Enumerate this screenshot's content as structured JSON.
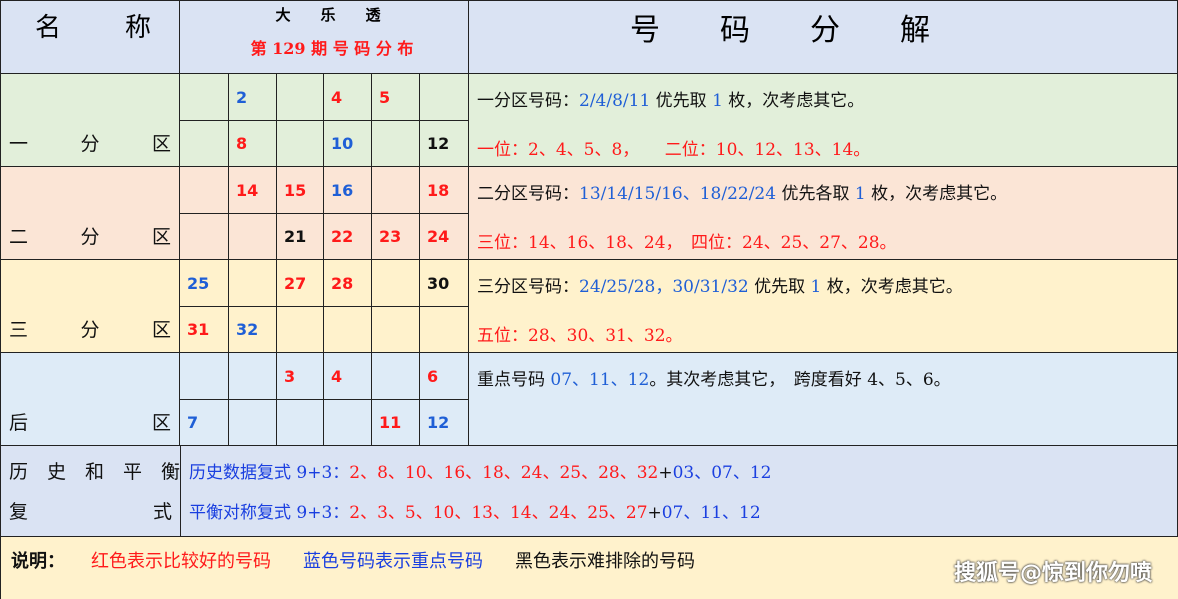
{
  "header": {
    "name_col": "名　　称",
    "subtitle_top": "大　　乐　　透",
    "subtitle_bottom": "第 129 期 号 码 分 布",
    "decompose_title": "号　　码　　分　　解"
  },
  "zones": [
    {
      "label": [
        "一",
        "分",
        "区"
      ],
      "rows": [
        [
          {
            "t": "",
            "c": ""
          },
          {
            "t": "2",
            "c": "blue"
          },
          {
            "t": "",
            "c": ""
          },
          {
            "t": "4",
            "c": "red"
          },
          {
            "t": "5",
            "c": "red"
          },
          {
            "t": "",
            "c": ""
          }
        ],
        [
          {
            "t": "",
            "c": ""
          },
          {
            "t": "8",
            "c": "red"
          },
          {
            "t": "",
            "c": ""
          },
          {
            "t": "10",
            "c": "blue"
          },
          {
            "t": "",
            "c": ""
          },
          {
            "t": "12",
            "c": "black"
          }
        ]
      ],
      "notes": [
        [
          {
            "t": "一分区号码：",
            "c": "black"
          },
          {
            "t": "2/4/8/11",
            "c": "blue"
          },
          {
            "t": " 优先取 ",
            "c": "black"
          },
          {
            "t": "1",
            "c": "blue"
          },
          {
            "t": " 枚，次考虑其它。",
            "c": "black"
          }
        ],
        [
          {
            "t": "一位：2、4、5、8，　　二位：10、12、13、14。",
            "c": "red"
          }
        ]
      ]
    },
    {
      "label": [
        "二",
        "分",
        "区"
      ],
      "rows": [
        [
          {
            "t": "",
            "c": ""
          },
          {
            "t": "14",
            "c": "red"
          },
          {
            "t": "15",
            "c": "red"
          },
          {
            "t": "16",
            "c": "blue"
          },
          {
            "t": "",
            "c": ""
          },
          {
            "t": "18",
            "c": "red"
          }
        ],
        [
          {
            "t": "",
            "c": ""
          },
          {
            "t": "",
            "c": ""
          },
          {
            "t": "21",
            "c": "black"
          },
          {
            "t": "22",
            "c": "red"
          },
          {
            "t": "23",
            "c": "red"
          },
          {
            "t": "24",
            "c": "red"
          }
        ]
      ],
      "notes": [
        [
          {
            "t": "二分区号码：",
            "c": "black"
          },
          {
            "t": "13/14/15/16、18/22/24",
            "c": "blue"
          },
          {
            "t": " 优先各取 ",
            "c": "black"
          },
          {
            "t": "1",
            "c": "blue"
          },
          {
            "t": " 枚，次考虑其它。",
            "c": "black"
          }
        ],
        [
          {
            "t": "三位：14、16、18、24，　四位：24、25、27、28。",
            "c": "red"
          }
        ]
      ]
    },
    {
      "label": [
        "三",
        "分",
        "区"
      ],
      "rows": [
        [
          {
            "t": "25",
            "c": "blue"
          },
          {
            "t": "",
            "c": ""
          },
          {
            "t": "27",
            "c": "red"
          },
          {
            "t": "28",
            "c": "red"
          },
          {
            "t": "",
            "c": ""
          },
          {
            "t": "30",
            "c": "black"
          }
        ],
        [
          {
            "t": "31",
            "c": "red"
          },
          {
            "t": "32",
            "c": "blue"
          },
          {
            "t": "",
            "c": ""
          },
          {
            "t": "",
            "c": ""
          },
          {
            "t": "",
            "c": ""
          },
          {
            "t": "",
            "c": ""
          }
        ]
      ],
      "notes": [
        [
          {
            "t": "三分区号码：",
            "c": "black"
          },
          {
            "t": "24/25/28，30/31/32",
            "c": "blue"
          },
          {
            "t": " 优先取 ",
            "c": "black"
          },
          {
            "t": "1",
            "c": "blue"
          },
          {
            "t": " 枚，次考虑其它。",
            "c": "black"
          }
        ],
        [
          {
            "t": "五位：28、30、31、32。",
            "c": "red"
          }
        ]
      ]
    },
    {
      "label": [
        "后",
        "",
        "区"
      ],
      "rows": [
        [
          {
            "t": "",
            "c": ""
          },
          {
            "t": "",
            "c": ""
          },
          {
            "t": "3",
            "c": "red"
          },
          {
            "t": "4",
            "c": "red"
          },
          {
            "t": "",
            "c": ""
          },
          {
            "t": "6",
            "c": "red"
          }
        ],
        [
          {
            "t": "7",
            "c": "blue"
          },
          {
            "t": "",
            "c": ""
          },
          {
            "t": "",
            "c": ""
          },
          {
            "t": "",
            "c": ""
          },
          {
            "t": "11",
            "c": "red"
          },
          {
            "t": "12",
            "c": "blue"
          }
        ]
      ],
      "notes": [
        [
          {
            "t": "重点号码 ",
            "c": "black"
          },
          {
            "t": "07、11、12",
            "c": "blue"
          },
          {
            "t": "。其次考虑其它，　跨度看好 4、5、6。",
            "c": "black"
          }
        ]
      ]
    }
  ],
  "compound": {
    "label_top": "历　史　和　平　衡",
    "label_bottom_a": "复",
    "label_bottom_b": "式",
    "lines": [
      [
        {
          "t": "历史数据复式 9+3：",
          "c": "b2"
        },
        {
          "t": "2、8、10、16、18、24、25、28、32",
          "c": "red"
        },
        {
          "t": "+",
          "c": "black"
        },
        {
          "t": "03、07、12",
          "c": "b2"
        }
      ],
      [
        {
          "t": "平衡对称复式 9+3：",
          "c": "b2"
        },
        {
          "t": "2、3、5、10、13、14、24、25、27",
          "c": "red"
        },
        {
          "t": "+",
          "c": "black"
        },
        {
          "t": "07、11、12",
          "c": "b2"
        }
      ]
    ]
  },
  "legend": {
    "intro": "说明：",
    "red_text": "红色表示比较好的号码",
    "blue_text": "蓝色号码表示重点号码",
    "black_text": "黑色表示难排除的号码"
  },
  "watermark": "搜狐号@惊到你勿喷",
  "colors": {
    "header_bg": "#dae3f3",
    "zone1_bg": "#e2efda",
    "zone2_bg": "#fbe5d6",
    "zone3_bg": "#fff2cc",
    "zone4_bg": "#deebf7",
    "compound_bg": "#dae3f3",
    "legend_bg": "#fff2cc",
    "red": "#ff1a1a",
    "blue": "#1f5fd6"
  }
}
